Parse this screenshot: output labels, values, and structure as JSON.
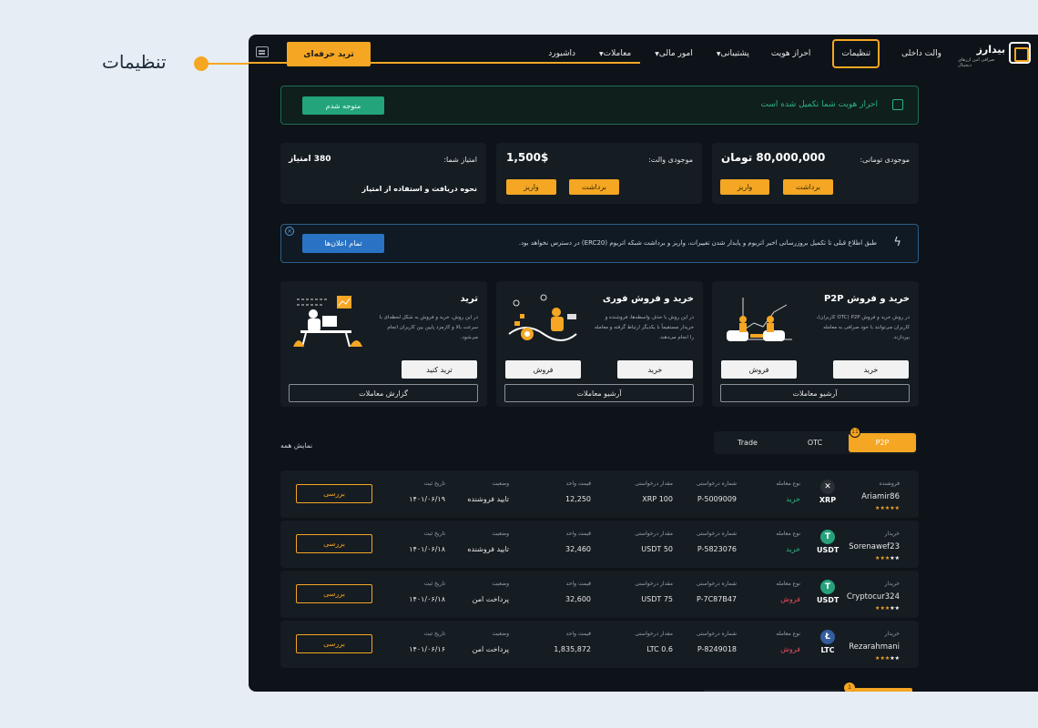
{
  "callout": {
    "label": "تنظیمات"
  },
  "brand": {
    "name": "بیدارز",
    "tagline": "صرافی امن ارزهای دیجیتال"
  },
  "nav": {
    "items": [
      {
        "label": "داشبورد",
        "dropdown": false
      },
      {
        "label": "معاملات",
        "dropdown": true
      },
      {
        "label": "امور مالی",
        "dropdown": true
      },
      {
        "label": "پشتیبانی",
        "dropdown": true
      },
      {
        "label": "احراز هویت",
        "dropdown": false
      },
      {
        "label": "تنظیمات",
        "dropdown": false,
        "active": true
      },
      {
        "label": "والت داخلی",
        "dropdown": false
      }
    ],
    "pro_trade": "ترید حرفه‌ای"
  },
  "verify": {
    "message": "احراز هویت شما تکمیل شده است",
    "button": "متوجه شدم"
  },
  "balances": {
    "toman": {
      "label": "موجودی تومانی:",
      "value": "80,000,000 تومان",
      "withdraw": "برداشت",
      "deposit": "واریز"
    },
    "wallet": {
      "label": "موجودی والت:",
      "value": "1,500$",
      "withdraw": "برداشت",
      "deposit": "واریز"
    },
    "points": {
      "label": "امتیاز شما:",
      "value": "380 امتیاز",
      "note": "نحوه دریافت و استفاده از امتیاز"
    }
  },
  "announcement": {
    "text": "طبق اطلاع قبلی تا تکمیل بروزرسانی اخیر اتریوم و پایدار شدن تغییرات، واریز و برداشت شبکه اتریوم (ERC20) در دسترس نخواهد بود.",
    "button": "تمام اعلان‌ها",
    "close": "×"
  },
  "features": {
    "p2p": {
      "title": "خرید و فروش P2P",
      "desc": "در روش خرید و فروش P2P (OTC کاربران)، کاربران می‌توانند با خود صرافی به معامله بپردازند.",
      "buy": "خرید",
      "sell": "فروش",
      "archive": "آرشیو معاملات"
    },
    "instant": {
      "title": "خرید و فروش فوری",
      "desc": "در این روش با حذف واسطه‌ها، فروشنده و خریدار مستقیماً با یکدیگر ارتباط گرفته و معامله را انجام می‌دهند.",
      "buy": "خرید",
      "sell": "فروش",
      "archive": "آرشیو معاملات"
    },
    "trade": {
      "title": "ترید",
      "desc": "در این روش، خرید و فروش به شکل لحظه‌ای با سرعت بالا و کارمزد پایین بین کاربران انجام می‌شود.",
      "action": "ترید کنید",
      "report": "گزارش معاملات"
    }
  },
  "tabs": {
    "items": [
      "P2P",
      "OTC",
      "Trade"
    ],
    "active": "P2P",
    "badge": "11",
    "show_all": "نمایش همه"
  },
  "columns": {
    "type": "نوع معامله",
    "request_no": "شماره درخواستی",
    "amount": "مقدار درخواستی",
    "unit_price": "قیمت واحد",
    "status": "وضعیت",
    "date": "تاریخ ثبت"
  },
  "rows": [
    {
      "role": "فروشنده",
      "user": "Ariamir86",
      "stars": 5,
      "coin": "XRP",
      "coin_glyph": "✕",
      "coin_color": "#2a2f35",
      "side": "خرید",
      "side_class": "buy",
      "request_no": "P-5009009",
      "amount": "100 XRP",
      "unit_price": "12,250",
      "status": "تایید فروشنده",
      "date": "۱۴۰۱/۰۶/۱۹",
      "action": "بررسی"
    },
    {
      "role": "خریدار",
      "user": "Sorenawef23",
      "stars": 3,
      "coin": "USDT",
      "coin_glyph": "T",
      "coin_color": "#26a17b",
      "side": "خرید",
      "side_class": "buy",
      "request_no": "P-5823076",
      "amount": "50 USDT",
      "unit_price": "32,460",
      "status": "تایید فروشنده",
      "date": "۱۴۰۱/۰۶/۱۸",
      "action": "بررسی"
    },
    {
      "role": "خریدار",
      "user": "Cryptocur324",
      "stars": 3,
      "coin": "USDT",
      "coin_glyph": "T",
      "coin_color": "#26a17b",
      "side": "فروش",
      "side_class": "sell",
      "request_no": "P-7C87B47",
      "amount": "75 USDT",
      "unit_price": "32,600",
      "status": "پرداخت امن",
      "date": "۱۴۰۱/۰۶/۱۸",
      "action": "بررسی"
    },
    {
      "role": "خریدار",
      "user": "Rezarahmani",
      "stars": 3,
      "coin": "LTC",
      "coin_glyph": "Ł",
      "coin_color": "#345d9d",
      "side": "فروش",
      "side_class": "sell",
      "request_no": "P-8249018",
      "amount": "0.6 LTC",
      "unit_price": "1,835,872",
      "status": "پرداخت امن",
      "date": "۱۴۰۱/۰۶/۱۶",
      "action": "بررسی"
    }
  ],
  "bottom": {
    "badge": "1"
  }
}
